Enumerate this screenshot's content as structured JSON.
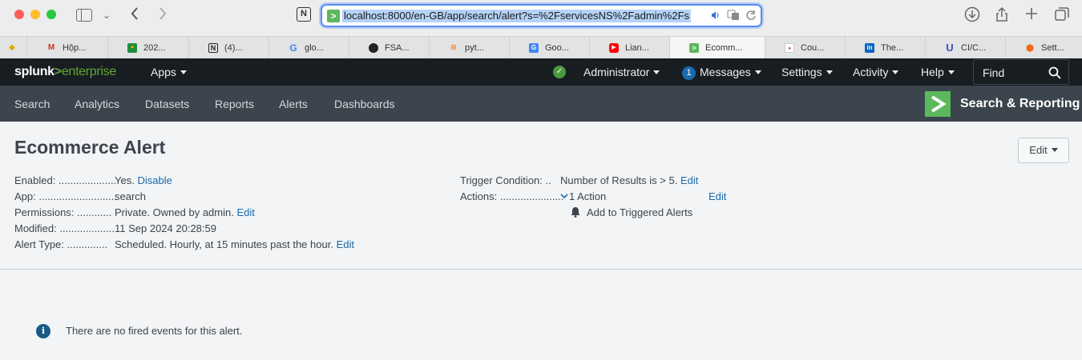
{
  "browser": {
    "url": "localhost:8000/en-GB/app/search/alert?s=%2FservicesNS%2Fadmin%2Fs",
    "tabs": [
      {
        "label": "Hộp...",
        "icon": "gmail-icon"
      },
      {
        "label": "202...",
        "icon": "classroom-icon"
      },
      {
        "label": "(4)...",
        "icon": "notion-icon"
      },
      {
        "label": "glo...",
        "icon": "google-icon"
      },
      {
        "label": "FSA...",
        "icon": "github-icon"
      },
      {
        "label": "pyt...",
        "icon": "stackoverflow-icon"
      },
      {
        "label": "Goo...",
        "icon": "google-translate-icon"
      },
      {
        "label": "Lian...",
        "icon": "youtube-icon"
      },
      {
        "label": "Ecomm...",
        "icon": "splunk-icon",
        "active": true
      },
      {
        "label": "Cou...",
        "icon": "course-icon"
      },
      {
        "label": "The...",
        "icon": "linkedin-icon"
      },
      {
        "label": "CI/C...",
        "icon": "udacity-icon"
      },
      {
        "label": "Sett...",
        "icon": "settings-cube-icon"
      }
    ]
  },
  "splunk": {
    "logo_splunk": "splunk",
    "logo_gt": ">",
    "logo_enterprise": "enterprise",
    "apps": "Apps",
    "user": "Administrator",
    "messages_count": "1",
    "messages": "Messages",
    "settings": "Settings",
    "activity": "Activity",
    "help": "Help",
    "find": "Find"
  },
  "app_nav": {
    "items": [
      "Search",
      "Analytics",
      "Datasets",
      "Reports",
      "Alerts",
      "Dashboards"
    ],
    "app_title": "Search & Reporting"
  },
  "alert": {
    "title": "Ecommerce Alert",
    "edit_button": "Edit",
    "enabled_label": "Enabled: ....................",
    "enabled_value": "Yes.",
    "disable_link": "Disable",
    "app_label": "App: ...........................",
    "app_value": "search",
    "permissions_label": "Permissions: ............",
    "permissions_value": "Private. Owned by admin.",
    "permissions_edit": "Edit",
    "modified_label": "Modified: ...................",
    "modified_value": "11 Sep 2024 20:28:59",
    "alert_type_label": "Alert Type: ..............",
    "alert_type_value": "Scheduled. Hourly, at 15 minutes past the hour.",
    "alert_type_edit": "Edit",
    "trigger_label": "Trigger Condition: ..",
    "trigger_value": "Number of Results is > 5.",
    "trigger_edit": "Edit",
    "actions_label": "Actions: ......................",
    "actions_value": "1 Action",
    "actions_edit": "Edit",
    "action_item": "Add to Triggered Alerts",
    "no_events": "There are no fired events for this alert."
  },
  "colors": {
    "splunk_green": "#65a637",
    "link_blue": "#1a6aae",
    "header_dark": "#171d21",
    "nav_gray": "#3c444d"
  }
}
